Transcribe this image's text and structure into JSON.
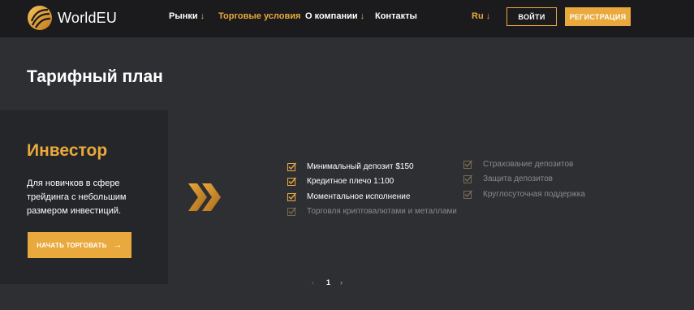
{
  "brand": {
    "name": "WorldEU"
  },
  "nav": [
    {
      "label": "Рынки",
      "dropdown": true,
      "active": false
    },
    {
      "label": "Торговые условия",
      "dropdown": false,
      "active": true
    },
    {
      "label": "О компании",
      "dropdown": true,
      "active": false
    },
    {
      "label": "Контакты",
      "dropdown": false,
      "active": false
    }
  ],
  "header": {
    "language": "Ru",
    "login_label": "ВОЙТИ",
    "register_label": "РЕГИСТРАЦИЯ"
  },
  "page": {
    "title": "Тарифный план"
  },
  "plan": {
    "name": "Инвестор",
    "description": "Для новичков в сфере трейдинга с небольшим размером инвестиций.",
    "cta_label": "НАЧАТЬ ТОРГОВАТЬ",
    "features_included": [
      "Минимальный депозит $150",
      "Кредитное плечо 1:100",
      "Моментальное исполнение"
    ],
    "features_excluded": [
      "Торговля криптовалютами и металлами",
      "Страхование депозитов",
      "Защита депозитов",
      "Круглосуточная поддержка"
    ]
  },
  "pagination": {
    "prev": "‹",
    "current": "1",
    "next": "›"
  },
  "colors": {
    "accent": "#e9a93c",
    "header_bg": "#1b1b1d",
    "page_bg": "#2e2f33",
    "card_bg": "#25262a"
  }
}
